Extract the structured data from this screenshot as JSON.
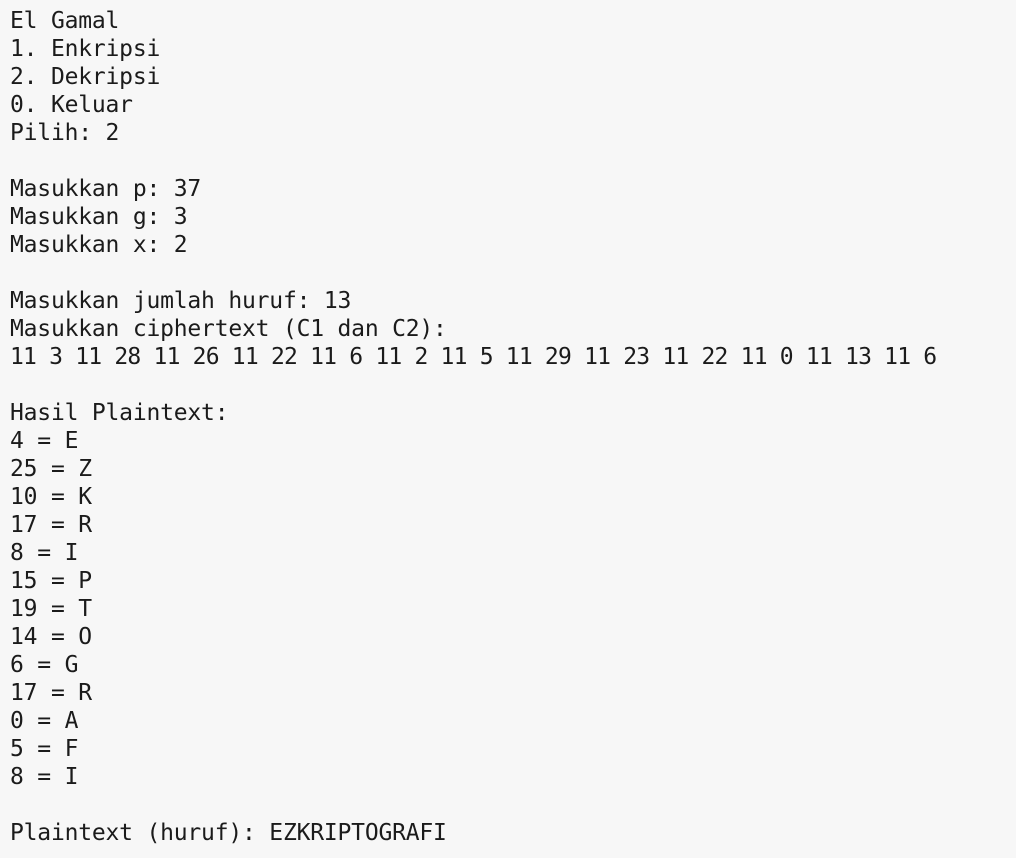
{
  "app": {
    "title": "El Gamal",
    "menu": [
      "1. Enkripsi",
      "2. Dekripsi",
      "0. Keluar"
    ],
    "choice_prompt": "Pilih: 2"
  },
  "inputs": {
    "p": "Masukkan p: 37",
    "g": "Masukkan g: 3",
    "x": "Masukkan x: 2"
  },
  "cipher": {
    "letter_count": "Masukkan jumlah huruf: 13",
    "prompt": "Masukkan ciphertext (C1 dan C2):",
    "values": "11 3 11 28 11 26 11 22 11 6 11 2 11 5 11 29 11 23 11 22 11 0 11 13 11 6"
  },
  "result": {
    "title": "Hasil Plaintext:",
    "rows": [
      "4 = E",
      "25 = Z",
      "10 = K",
      "17 = R",
      "8 = I",
      "15 = P",
      "19 = T",
      "14 = O",
      "6 = G",
      "17 = R",
      "0 = A",
      "5 = F",
      "8 = I"
    ],
    "summary": "Plaintext (huruf): EZKRIPTOGRAFI"
  }
}
